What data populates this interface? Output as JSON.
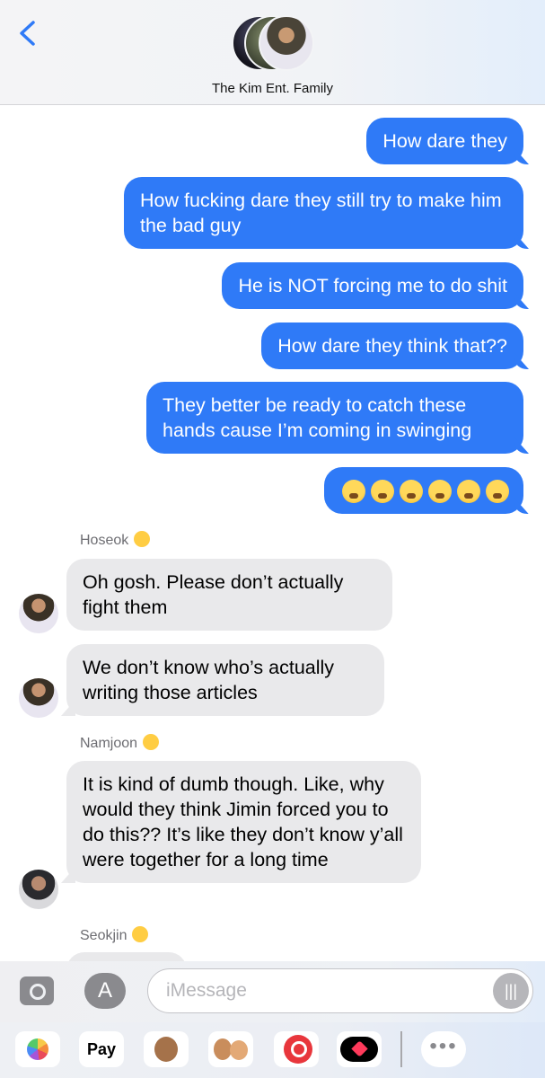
{
  "header": {
    "group_name": "The Kim Ent. Family"
  },
  "messages": {
    "out": [
      "How dare they",
      "How fucking dare they still try to make him the bad guy",
      "He is NOT forcing me to do shit",
      "How dare they think that??",
      "They better be ready to catch these hands cause I’m coming in swinging"
    ],
    "out_emoji": "😤😤😤😤😤😤"
  },
  "senders": {
    "hoseok": "Hoseok",
    "namjoon": "Namjoon",
    "seokjin": "Seokjin"
  },
  "incoming": {
    "hoseok_1": "Oh gosh. Please don’t actually fight them",
    "hoseok_2": "We don’t know who’s actually writing those articles",
    "namjoon_1": "It is kind of dumb though. Like, why would they think Jimin forced you to do this?? It’s like they don’t know y’all were together for a long time"
  },
  "compose": {
    "placeholder": "iMessage"
  },
  "app_drawer": {
    "apple_pay_label": "Pay",
    "more_label": "•••"
  },
  "colors": {
    "outgoing_bubble": "#2f7af7",
    "incoming_bubble": "#e9e9eb",
    "accent": "#2f7af7"
  },
  "icons": [
    "chevron-left-icon",
    "camera-icon",
    "app-store-icon",
    "audio-waveform-icon",
    "photos-icon",
    "apple-pay-icon",
    "animoji-icon",
    "memoji-icon",
    "web-search-icon",
    "digital-touch-icon",
    "more-icon"
  ]
}
